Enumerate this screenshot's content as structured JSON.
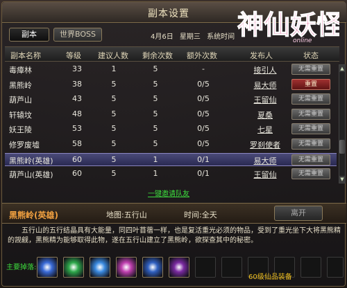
{
  "window": {
    "title": "副本设置"
  },
  "tabs": [
    {
      "label": "副本"
    },
    {
      "label": "世界BOSS"
    }
  ],
  "date": {
    "day": "4月6日",
    "weekday": "星期三",
    "system_time": "系统时间"
  },
  "table": {
    "headers": [
      "副本名称",
      "等级",
      "建议人数",
      "剩余次数",
      "额外次数",
      "发布人",
      "状态"
    ],
    "rows": [
      {
        "name": "毒瘴林",
        "level": "33",
        "suggested": "1",
        "remaining": "5",
        "extra": "-",
        "publisher": "接引人",
        "status": "无需重置"
      },
      {
        "name": "黑熊岭",
        "level": "38",
        "suggested": "5",
        "remaining": "5",
        "extra": "0/5",
        "publisher": "易大师",
        "status": "重置"
      },
      {
        "name": "葫芦山",
        "level": "43",
        "suggested": "5",
        "remaining": "5",
        "extra": "0/5",
        "publisher": "王留仙",
        "status": "无需重置"
      },
      {
        "name": "轩辕坟",
        "level": "48",
        "suggested": "5",
        "remaining": "5",
        "extra": "0/5",
        "publisher": "夏桑",
        "status": "无需重置"
      },
      {
        "name": "妖王陵",
        "level": "53",
        "suggested": "5",
        "remaining": "5",
        "extra": "0/5",
        "publisher": "七星",
        "status": "无需重置"
      },
      {
        "name": "修罗废墟",
        "level": "58",
        "suggested": "5",
        "remaining": "5",
        "extra": "0/5",
        "publisher": "罗刹使者",
        "status": "无需重置"
      },
      {
        "name": "黑熊岭(英雄)",
        "level": "60",
        "suggested": "5",
        "remaining": "1",
        "extra": "0/1",
        "publisher": "易大师",
        "status": "无需重置"
      },
      {
        "name": "葫芦山(英雄)",
        "level": "60",
        "suggested": "5",
        "remaining": "1",
        "extra": "0/1",
        "publisher": "王留仙",
        "status": "无需重置"
      }
    ]
  },
  "invite_link": "一键邀请队友",
  "detail": {
    "name": "黑熊岭(英雄)",
    "map": "地图:五行山",
    "time": "时间:全天",
    "leave_button": "离开",
    "description": "五行山的五行结晶具有大能量，同四叶苜蓿一样，也是复活重光必须的物品，受到了重光坐下大将黑熊精的觊觎，黑熊精为能够取得此物，遂在五行山建立了黑熊岭，欲探查其中的秘密。"
  },
  "drops": {
    "label": "主要掉落:",
    "equip_label": "60级仙品装备",
    "items": [
      {
        "icon": "blue-rune-icon",
        "color": "#3a6bd8"
      },
      {
        "icon": "green-rune-icon",
        "color": "#2ea84a"
      },
      {
        "icon": "blue-dragon-icon",
        "color": "#3a8ae0"
      },
      {
        "icon": "magenta-gem-icon",
        "color": "#c040b0"
      },
      {
        "icon": "blue-moon-icon",
        "color": "#3060c0"
      },
      {
        "icon": "green-pink-potion-icon",
        "color": "#7a2aa0"
      }
    ]
  }
}
